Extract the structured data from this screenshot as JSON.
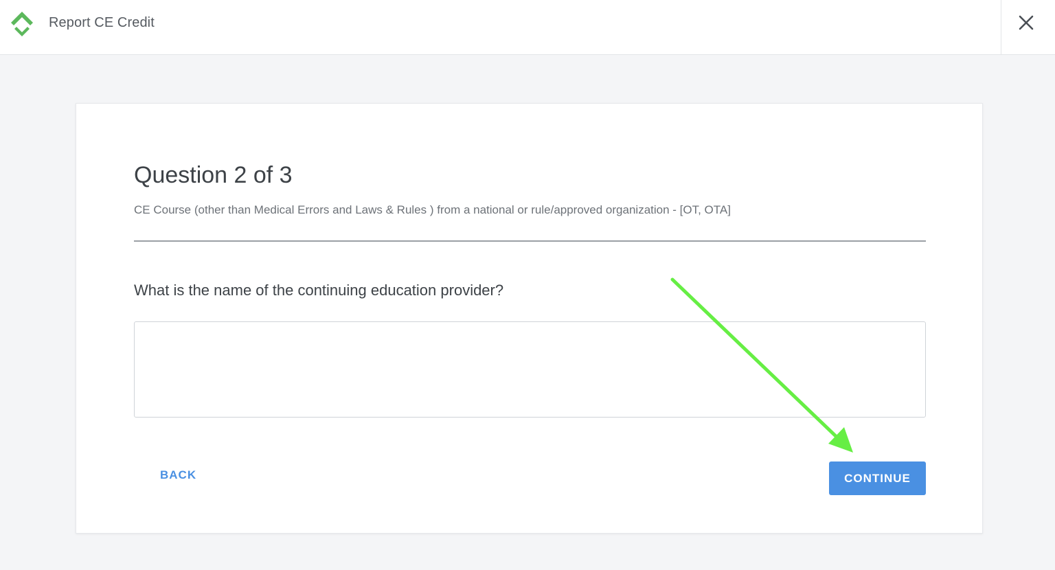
{
  "header": {
    "title": "Report CE Credit",
    "logo_icon": "diamond-check-logo",
    "close_icon": "close-icon"
  },
  "question": {
    "title": "Question 2 of 3",
    "subtitle": "CE Course (other than Medical Errors and Laws & Rules ) from a national or rule/approved organization - [OT, OTA]",
    "prompt": "What is the name of the continuing education provider?",
    "answer_value": ""
  },
  "actions": {
    "back_label": "BACK",
    "continue_label": "CONTINUE"
  },
  "colors": {
    "accent": "#4a90e2",
    "logo_green": "#5cb85c",
    "annotation_arrow": "#66ee44"
  }
}
